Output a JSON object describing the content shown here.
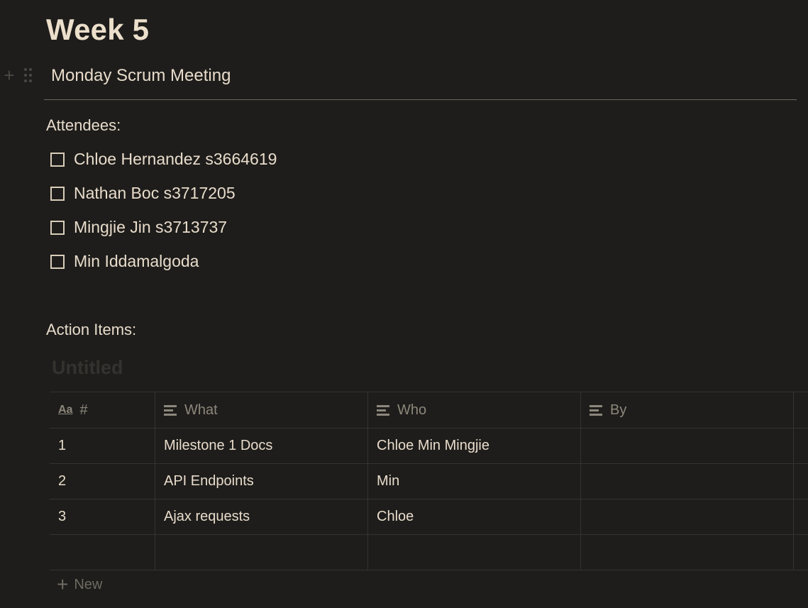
{
  "page": {
    "title": "Week 5",
    "subheading": "Monday Scrum Meeting"
  },
  "attendees": {
    "label": "Attendees:",
    "items": [
      {
        "text": "Chloe Hernandez s3664619",
        "checked": false
      },
      {
        "text": "Nathan Boc s3717205",
        "checked": false
      },
      {
        "text": "Mingjie Jin s3713737",
        "checked": false
      },
      {
        "text": "Min Iddamalgoda",
        "checked": false
      }
    ]
  },
  "action_items": {
    "label": "Action Items:",
    "database_title": "Untitled",
    "columns": [
      "#",
      "What",
      "Who",
      "By"
    ],
    "title_icon": "Aa",
    "rows": [
      {
        "num": "1",
        "what": "Milestone 1 Docs",
        "who": "Chloe Min Mingjie",
        "by": ""
      },
      {
        "num": "2",
        "what": "API Endpoints",
        "who": "Min",
        "by": ""
      },
      {
        "num": "3",
        "what": "Ajax requests",
        "who": "Chloe",
        "by": ""
      }
    ],
    "new_label": "New"
  },
  "colors": {
    "background": "#1e1d1b",
    "text": "#e8dccb",
    "muted": "#8d877c",
    "border": "#353330"
  }
}
